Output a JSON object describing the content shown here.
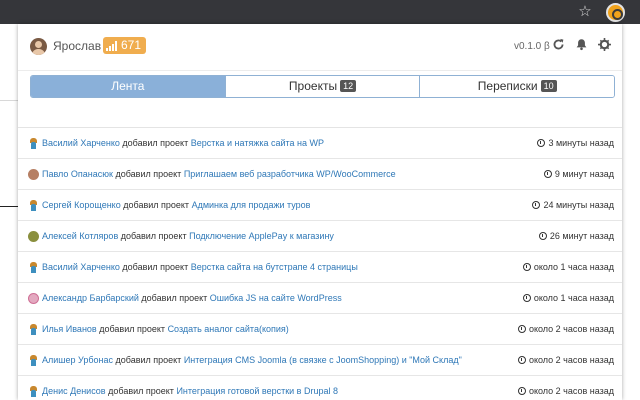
{
  "header": {
    "username": "Ярослав",
    "rating": "671",
    "version": "v0.1.0 β"
  },
  "tabs": [
    {
      "label": "Лента",
      "count": null,
      "active": true
    },
    {
      "label": "Проекты",
      "count": "12",
      "active": false
    },
    {
      "label": "Переписки",
      "count": "10",
      "active": false
    }
  ],
  "feed": [
    {
      "avatar": "person",
      "user": "Василий Харченко",
      "action": "добавил проект",
      "project": "Верстка и натяжка сайта на WP",
      "time": "3 минуты назад"
    },
    {
      "avatar": "photo1",
      "user": "Павло Опанасюк",
      "action": "добавил проект",
      "project": "Приглашаем веб разработчика WP/WooCommerce",
      "time": "9 минут назад"
    },
    {
      "avatar": "person",
      "user": "Сергей Корощенко",
      "action": "добавил проект",
      "project": "Админка для продажи туров",
      "time": "24 минуты назад"
    },
    {
      "avatar": "photo2",
      "user": "Алексей Котляров",
      "action": "добавил проект",
      "project": "Подключение ApplePay к магазину",
      "time": "26 минут назад"
    },
    {
      "avatar": "person",
      "user": "Василий Харченко",
      "action": "добавил проект",
      "project": "Верстка сайта на бутстрапе 4 страницы",
      "time": "около 1 часа назад"
    },
    {
      "avatar": "photo3",
      "user": "Александр Барбарский",
      "action": "добавил проект",
      "project": "Ошибка JS на сайте WordPress",
      "time": "около 1 часа назад"
    },
    {
      "avatar": "person",
      "user": "Илья Иванов",
      "action": "добавил проект",
      "project": "Создать аналог сайта(копия)",
      "time": "около 2 часов назад"
    },
    {
      "avatar": "person",
      "user": "Алишер Урбонас",
      "action": "добавил проект",
      "project": "Интеграция CMS Joomla (в связке с JoomShopping) и \"Мой Склад\"",
      "time": "около 2 часов назад"
    },
    {
      "avatar": "person",
      "user": "Денис Денисов",
      "action": "добавил проект",
      "project": "Интеграция готовой верстки в Drupal 8",
      "time": "около 2 часов назад"
    }
  ]
}
